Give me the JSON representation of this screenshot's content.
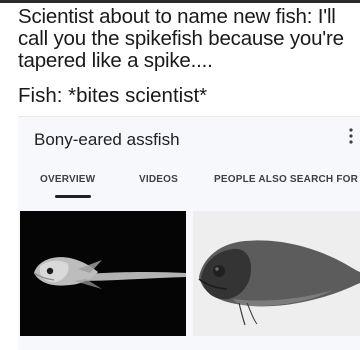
{
  "caption": {
    "lines": [
      "Scientist about to name new fish: I'll",
      "call you the spikefish because you're",
      "tapered like a spike...."
    ],
    "fish_line": "Fish: *bites scientist*"
  },
  "card": {
    "title": "Bony-eared assfish",
    "more_icon": "more-vert-icon",
    "tabs": [
      {
        "label": "OVERVIEW",
        "active": true
      },
      {
        "label": "VIDEOS",
        "active": false
      },
      {
        "label": "PEOPLE ALSO SEARCH FOR",
        "active": false
      }
    ],
    "images": [
      {
        "name": "fish-photo-dark-background"
      },
      {
        "name": "fish-photo-light-background"
      }
    ]
  },
  "colors": {
    "text": "#1a1a1a",
    "card_background": "#f7f8fb",
    "tab_text": "#3c4043",
    "active_underline": "#202124"
  }
}
